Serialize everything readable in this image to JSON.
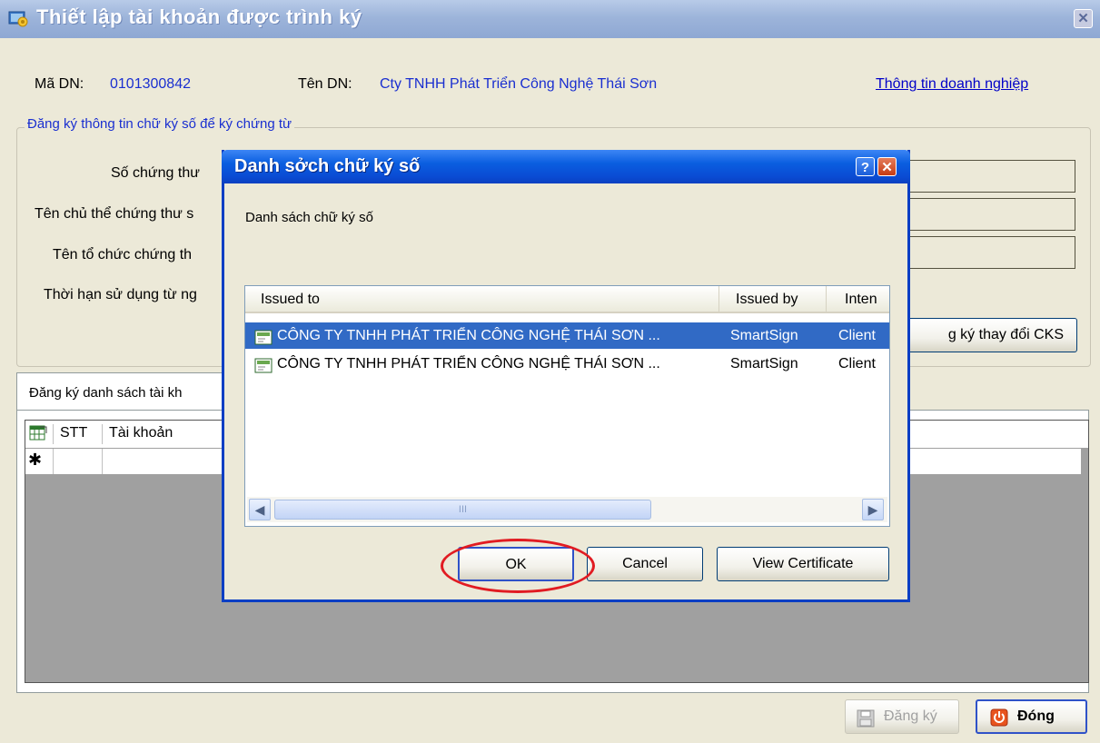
{
  "main_window": {
    "title": "Thiết lập tài khoản được trình ký",
    "ma_dn_label": "Mã DN:",
    "ma_dn_value": "0101300842",
    "ten_dn_label": "Tên DN:",
    "ten_dn_value": "Cty TNHH Phát Triển Công Nghệ Thái Sơn",
    "company_info_link": "Thông tin doanh nghiệp",
    "signature_group_title": "Đăng ký thông tin chữ ký số để ký chứng từ",
    "field_labels": {
      "cert_number": "Số chứng thư",
      "cert_subject": "Tên chủ thể chứng thư s",
      "cert_org": "Tên tổ chức chứng th",
      "validity": "Thời hạn sử dụng từ ng"
    },
    "change_cks_button": "g ký thay đổi CKS",
    "accounts_tab_label": "Đăng ký danh sách tài kh",
    "grid_columns": [
      "STT",
      "Tài khoản"
    ],
    "new_row_marker": "✱",
    "register_button": "Đăng ký",
    "close_button": "Đóng"
  },
  "dialog": {
    "title": "Danh sởch chữ ký số",
    "help_glyph": "?",
    "close_glyph": "✕",
    "subtitle": "Danh sách chữ ký số",
    "columns": {
      "issued_to": "Issued to",
      "issued_by": "Issued by",
      "intended": "Inten"
    },
    "rows": [
      {
        "issued_to": "CÔNG TY TNHH PHÁT TRIỂN CÔNG NGHỆ THÁI SƠN ...",
        "issued_by": "SmartSign",
        "intended": "Client",
        "selected": true
      },
      {
        "issued_to": "CÔNG TY TNHH PHÁT TRIỂN CÔNG NGHỆ THÁI SƠN ...",
        "issued_by": "SmartSign",
        "intended": "Client",
        "selected": false
      }
    ],
    "ok_button": "OK",
    "cancel_button": "Cancel",
    "view_cert_button": "View Certificate",
    "scroll_grip": "III"
  },
  "colors": {
    "dialog_title_blue": "#0a5ee0",
    "selection_blue": "#316ac5",
    "highlight_ring": "#e11b22",
    "link_blue": "#1a2fd0"
  },
  "icons": {
    "window": "settings-window-icon",
    "certificate": "certificate-icon",
    "excel": "excel-export-icon",
    "save": "save-disk-icon",
    "power": "power-icon"
  }
}
